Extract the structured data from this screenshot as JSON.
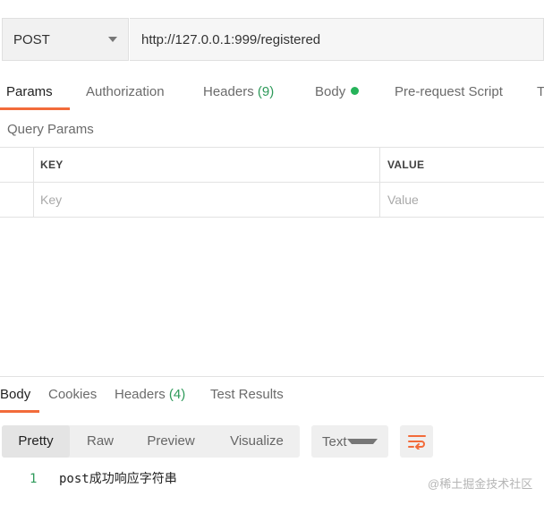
{
  "request": {
    "method": "POST",
    "url": "http://127.0.0.1:999/registered"
  },
  "request_tabs": {
    "params": "Params",
    "authorization": "Authorization",
    "headers": "Headers",
    "headers_count": "(9)",
    "body": "Body",
    "prerequest": "Pre-request Script",
    "tests_partial": "T"
  },
  "query_params": {
    "title": "Query Params",
    "col_key": "KEY",
    "col_value": "VALUE",
    "key_placeholder": "Key",
    "value_placeholder": "Value"
  },
  "response_tabs": {
    "body": "Body",
    "cookies": "Cookies",
    "headers": "Headers",
    "headers_count": "(4)",
    "test_results": "Test Results"
  },
  "view_modes": [
    "Pretty",
    "Raw",
    "Preview",
    "Visualize"
  ],
  "format": "Text",
  "response_body": [
    {
      "line": "1",
      "text": "post成功响应字符串"
    }
  ],
  "watermark": "@稀土掘金技术社区",
  "colors": {
    "accent": "#f26b3a",
    "count": "#2e9a5a",
    "body_dot": "#26b35a"
  },
  "icons": {
    "method_dropdown": "chevron-down-icon",
    "format_dropdown": "chevron-down-icon",
    "wrap": "wrap-lines-icon",
    "body_indicator": "dot-icon"
  }
}
